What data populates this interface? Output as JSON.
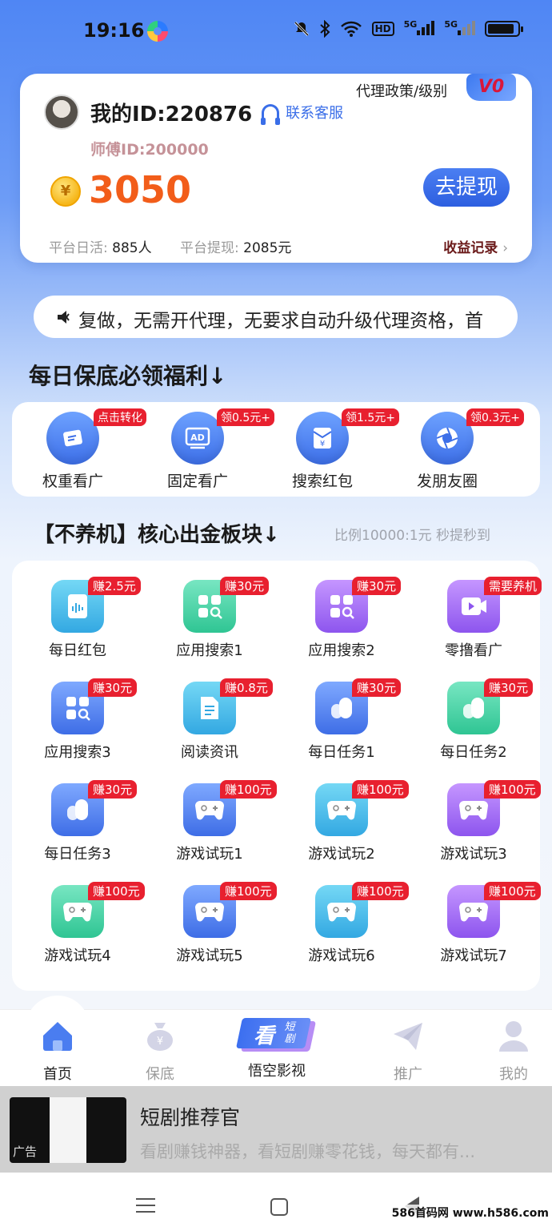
{
  "status": {
    "time": "19:16",
    "network1": "5G",
    "network2": "5G",
    "hd": "HD"
  },
  "account": {
    "my_id": "我的ID:220876",
    "service_label": "联系客服",
    "agent_policy": "代理政策/级别",
    "level": "V0",
    "master_id": "师傅ID:200000",
    "coin_symbol": "¥",
    "balance": "3050",
    "withdraw_label": "去提现",
    "daily_active_label": "平台日活:",
    "daily_active_value": "885人",
    "platform_withdraw_label": "平台提现:",
    "platform_withdraw_value": "2085元",
    "records_label": "收益记录"
  },
  "notice": {
    "text": "复做，无需开代理，无要求自动升级代理资格，首"
  },
  "welfare": {
    "title": "每日保底必领福利↓",
    "items": [
      {
        "label": "权重看广",
        "tag": "点击转化",
        "icon": "card-icon"
      },
      {
        "label": "固定看广",
        "tag": "领0.5元+",
        "icon": "ad-icon"
      },
      {
        "label": "搜索红包",
        "tag": "领1.5元+",
        "icon": "red-envelope-icon"
      },
      {
        "label": "发朋友圈",
        "tag": "领0.3元+",
        "icon": "camera-shutter-icon"
      }
    ]
  },
  "core": {
    "title": "【不养机】核心出金板块↓",
    "subtitle": "比例10000:1元  秒提秒到",
    "items": [
      {
        "label": "每日红包",
        "tag": "赚2.5元",
        "color": "cyan"
      },
      {
        "label": "应用搜索1",
        "tag": "赚30元",
        "color": "green"
      },
      {
        "label": "应用搜索2",
        "tag": "赚30元",
        "color": "purple"
      },
      {
        "label": "零撸看广",
        "tag": "需要养机",
        "color": "purple"
      },
      {
        "label": "应用搜索3",
        "tag": "赚30元",
        "color": "blue"
      },
      {
        "label": "阅读资讯",
        "tag": "赚0.8元",
        "color": "cyan"
      },
      {
        "label": "每日任务1",
        "tag": "赚30元",
        "color": "blue"
      },
      {
        "label": "每日任务2",
        "tag": "赚30元",
        "color": "green"
      },
      {
        "label": "每日任务3",
        "tag": "赚30元",
        "color": "blue"
      },
      {
        "label": "游戏试玩1",
        "tag": "赚100元",
        "color": "blue"
      },
      {
        "label": "游戏试玩2",
        "tag": "赚100元",
        "color": "cyan"
      },
      {
        "label": "游戏试玩3",
        "tag": "赚100元",
        "color": "purple"
      },
      {
        "label": "游戏试玩4",
        "tag": "赚100元",
        "color": "green"
      },
      {
        "label": "游戏试玩5",
        "tag": "赚100元",
        "color": "blue"
      },
      {
        "label": "游戏试玩6",
        "tag": "赚100元",
        "color": "cyan"
      },
      {
        "label": "游戏试玩7",
        "tag": "赚100元",
        "color": "purple"
      }
    ]
  },
  "tabs": [
    {
      "label": "首页",
      "icon": "home-icon",
      "active": true
    },
    {
      "label": "保底",
      "icon": "money-bag-icon",
      "active": false
    },
    {
      "label": "悟空影视",
      "icon": "short-drama-icon",
      "active": false,
      "badge_main": "看",
      "badge_sub": "短剧"
    },
    {
      "label": "推广",
      "icon": "paper-plane-icon",
      "active": false
    },
    {
      "label": "我的",
      "icon": "profile-icon",
      "active": false
    }
  ],
  "ad": {
    "title": "短剧推荐官",
    "desc": "看剧赚钱神器，看短剧赚零花钱，每天都有...",
    "label": "广告"
  },
  "watermark": "586首码网 www.h586.com"
}
